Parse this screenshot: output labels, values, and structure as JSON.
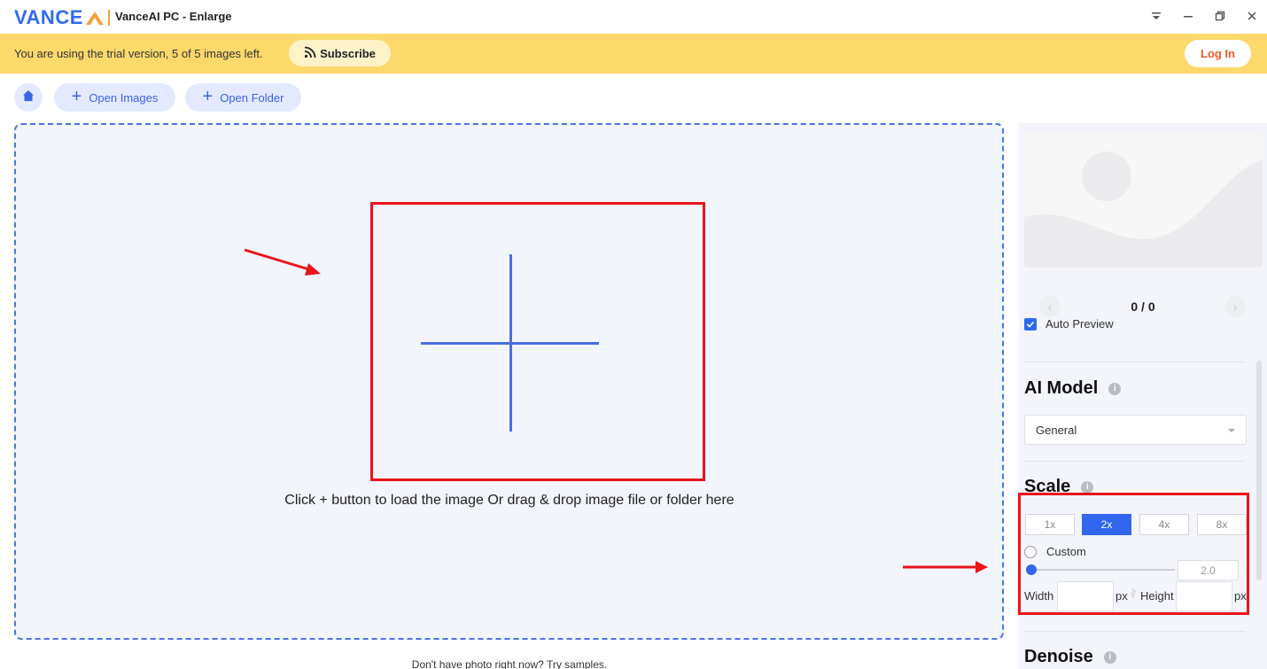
{
  "window": {
    "logo_text": "VANCE",
    "title": "VanceAI PC - Enlarge",
    "controls": [
      "menu-icon",
      "minimize-icon",
      "restore-icon",
      "close-icon"
    ]
  },
  "banner": {
    "text": "You are using the trial version, 5 of 5 images left.",
    "subscribe_label": "Subscribe",
    "login_label": "Log In"
  },
  "toolbar": {
    "open_images_label": "Open Images",
    "open_folder_label": "Open Folder"
  },
  "dropzone": {
    "hint": "Click + button to load the image Or drag & drop image file or folder here",
    "samples_text": "Don't have photo right now? Try samples."
  },
  "panel": {
    "counter": "0 / 0",
    "auto_preview_label": "Auto Preview",
    "auto_preview_checked": true,
    "ai_model_title": "AI Model",
    "ai_model_value": "General",
    "scale_title": "Scale",
    "scale_options": [
      "1x",
      "2x",
      "4x",
      "8x"
    ],
    "scale_selected": "2x",
    "custom_label": "Custom",
    "slider_value": "2.0",
    "width_label": "Width",
    "px_label": "px",
    "height_label": "Height",
    "denoise_title": "Denoise"
  },
  "colors": {
    "accent": "#3366ee",
    "banner": "#fdd86b",
    "annotation": "#e8141b",
    "login_text": "#ef5a2a"
  }
}
